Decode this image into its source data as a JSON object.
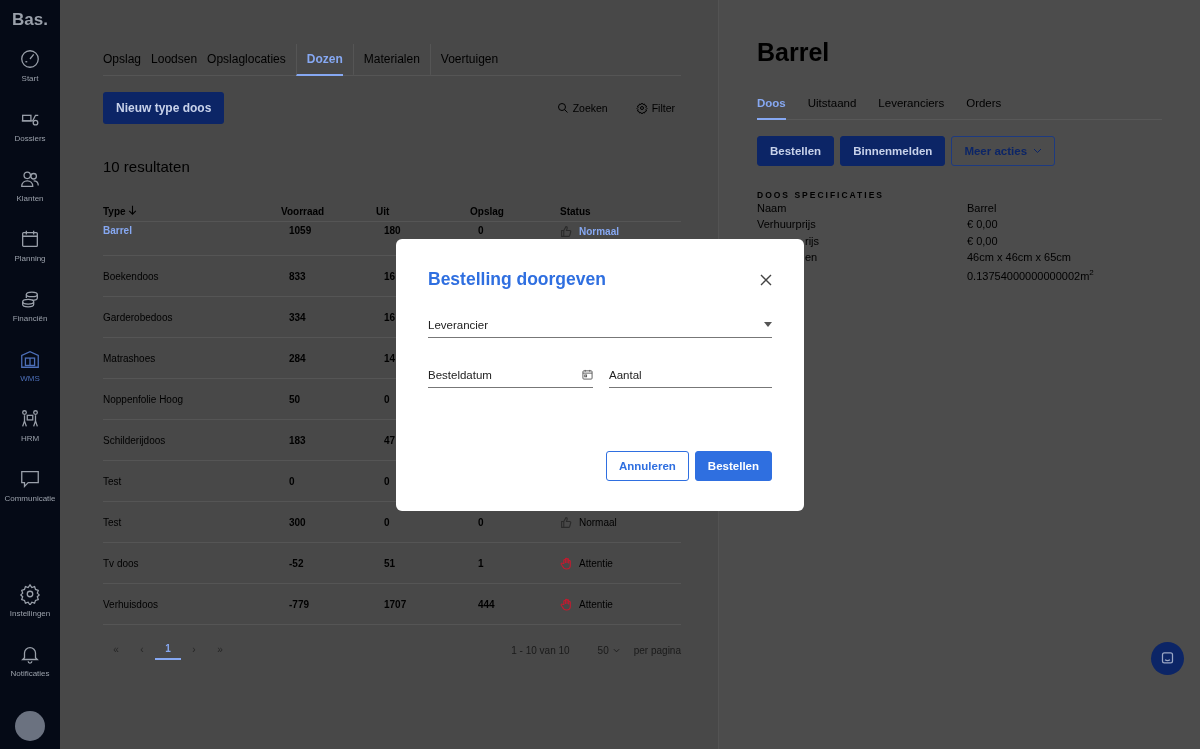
{
  "sidebar": {
    "logo": "Bas",
    "logo_dot": ".",
    "items": [
      {
        "label": "Start",
        "selected": false
      },
      {
        "label": "Dossiers",
        "selected": false
      },
      {
        "label": "Klanten",
        "selected": false
      },
      {
        "label": "Planning",
        "selected": false
      },
      {
        "label": "Financiën",
        "selected": false
      },
      {
        "label": "WMS",
        "selected": true
      },
      {
        "label": "HRM",
        "selected": false
      },
      {
        "label": "Communicatie",
        "selected": false
      }
    ],
    "bottom_items": [
      {
        "label": "Instellingen"
      },
      {
        "label": "Notificaties"
      }
    ]
  },
  "tabs": [
    {
      "label": "Opslag",
      "selected": false
    },
    {
      "label": "Loodsen",
      "selected": false
    },
    {
      "label": "Opslaglocaties",
      "selected": false
    },
    {
      "label": "Dozen",
      "selected": true
    },
    {
      "label": "Materialen",
      "selected": false
    },
    {
      "label": "Voertuigen",
      "selected": false
    }
  ],
  "new_button": "Nieuw type doos",
  "toolbar": {
    "search": "Zoeken",
    "filter": "Filter"
  },
  "result_count": "10 resultaten",
  "table": {
    "columns": [
      "Type",
      "Voorraad",
      "Uit",
      "Opslag",
      "Status"
    ],
    "rows": [
      {
        "type": "Barrel",
        "link": true,
        "voorraad": "1059",
        "uit": "180",
        "opslag": "0",
        "status": "Normaal",
        "kind": "normal"
      },
      {
        "type": "Boekendoos",
        "link": false,
        "voorraad": "833",
        "uit": "16"
      },
      {
        "type": "Garderobedoos",
        "link": false,
        "voorraad": "334",
        "uit": "16"
      },
      {
        "type": "Matrashoes",
        "link": false,
        "voorraad": "284",
        "uit": "14"
      },
      {
        "type": "Noppenfolie Hoog",
        "link": false,
        "voorraad": "50",
        "uit": "0"
      },
      {
        "type": "Schilderijdoos",
        "link": false,
        "voorraad": "183",
        "uit": "47"
      },
      {
        "type": "Test",
        "link": false,
        "voorraad": "0",
        "uit": "0"
      },
      {
        "type": "Test",
        "link": false,
        "voorraad": "300",
        "uit": "0",
        "opslag": "0",
        "status": "Normaal",
        "kind": "normal"
      },
      {
        "type": "Tv doos",
        "link": false,
        "voorraad": "-52",
        "uit": "51",
        "opslag": "1",
        "status": "Attentie",
        "kind": "attention"
      },
      {
        "type": "Verhuisdoos",
        "link": false,
        "voorraad": "-779",
        "uit": "1707",
        "opslag": "444",
        "status": "Attentie",
        "kind": "attention"
      }
    ]
  },
  "pagination": {
    "pages": [
      {
        "label": "«",
        "selected": false
      },
      {
        "label": "‹",
        "selected": false
      },
      {
        "label": "1",
        "selected": true
      },
      {
        "label": "›",
        "selected": false
      },
      {
        "label": "»",
        "selected": false
      }
    ],
    "range": "1 - 10 van 10",
    "per_page": "50",
    "per_page_label": "per pagina"
  },
  "detail": {
    "title": "Barrel",
    "tabs": [
      {
        "label": "Doos",
        "selected": true
      },
      {
        "label": "Uitstaand",
        "selected": false
      },
      {
        "label": "Leveranciers",
        "selected": false
      },
      {
        "label": "Orders",
        "selected": false
      }
    ],
    "buttons": [
      {
        "label": "Bestellen",
        "kind": "primary"
      },
      {
        "label": "Binnenmelden",
        "kind": "primary"
      },
      {
        "label": "Meer acties",
        "kind": "dropdown"
      }
    ],
    "spec_title": "DOOS SPECIFICATIES",
    "specs": [
      {
        "label": "Naam",
        "value": "Barrel"
      },
      {
        "label": "Verhuurprijs",
        "value": "€ 0,00"
      },
      {
        "label": "rijs",
        "partial": true,
        "value": "€ 0,00"
      },
      {
        "label": "en",
        "partial": true,
        "value": "46cm x 46cm x 65cm"
      },
      {
        "value": "0.13754000000000002m$^{2}$"
      }
    ]
  },
  "dialog": {
    "title": "Bestelling doorgeven",
    "fields": [
      {
        "placeholder": "Leverancier",
        "kind": "select"
      },
      {
        "placeholder": "Besteldatum",
        "kind": "date"
      },
      {
        "placeholder": "Aantal",
        "kind": "text"
      }
    ],
    "buttons": [
      {
        "label": "Annuleren",
        "kind": "secondary"
      },
      {
        "label": "Bestellen",
        "kind": "primary"
      }
    ]
  }
}
